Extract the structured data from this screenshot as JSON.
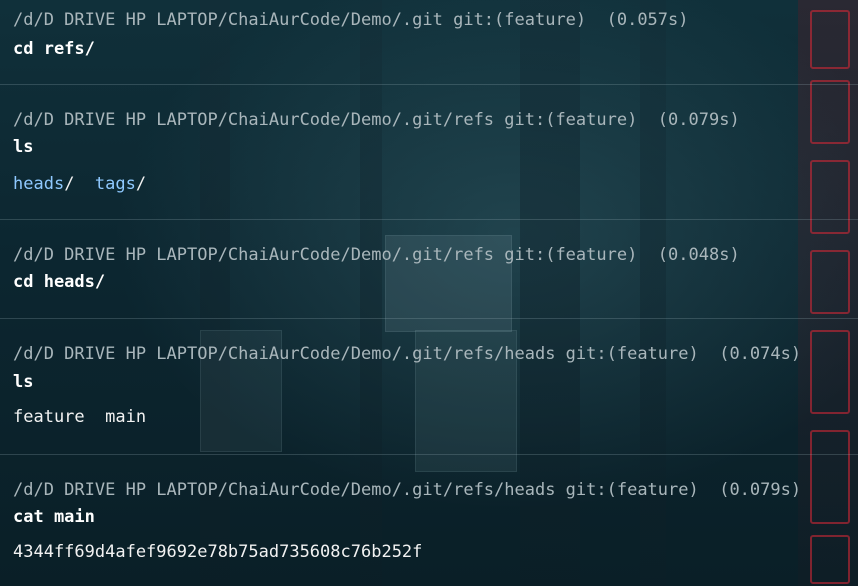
{
  "terminal": {
    "blocks": [
      {
        "prompt": "/d/D DRIVE HP LAPTOP/ChaiAurCode/Demo/.git git:(feature)  (0.057s)",
        "command": "cd refs/"
      },
      {
        "prompt": "/d/D DRIVE HP LAPTOP/ChaiAurCode/Demo/.git/refs git:(feature)  (0.079s)",
        "command": "ls",
        "output_dirs": [
          "heads",
          "tags"
        ]
      },
      {
        "prompt": "/d/D DRIVE HP LAPTOP/ChaiAurCode/Demo/.git/refs git:(feature)  (0.048s)",
        "command": "cd heads/"
      },
      {
        "prompt": "/d/D DRIVE HP LAPTOP/ChaiAurCode/Demo/.git/refs/heads git:(feature)  (0.074s)",
        "command": "ls",
        "output": "feature  main"
      },
      {
        "prompt": "/d/D DRIVE HP LAPTOP/ChaiAurCode/Demo/.git/refs/heads git:(feature)  (0.079s)",
        "command": "cat main",
        "output": "4344ff69d4afef9692e78b75ad735608c76b252f"
      }
    ]
  },
  "colors": {
    "prompt": "#a9b6bb",
    "command": "#ffffff",
    "directory": "#8fc9ff",
    "separator": "#96afb9"
  }
}
